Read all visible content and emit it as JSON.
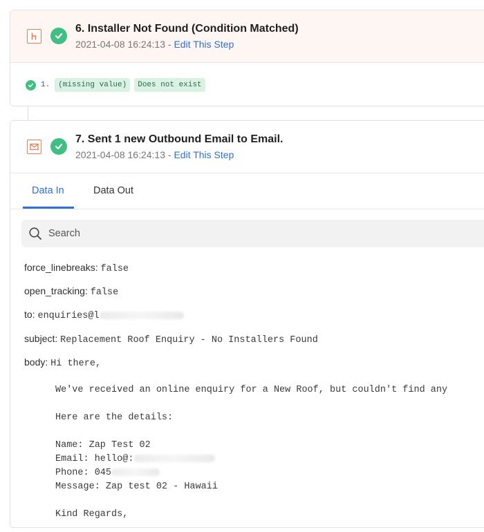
{
  "step6": {
    "title": "6. Installer Not Found (Condition Matched)",
    "timestamp": "2021-04-08 16:24:13",
    "separator": " - ",
    "edit_label": "Edit This Step",
    "app_icon": "filter-icon",
    "condition": {
      "number": "1.",
      "value_tag": "(missing value)",
      "operator_tag": "Does not exist"
    }
  },
  "step7": {
    "title": "7. Sent 1 new Outbound Email to Email.",
    "timestamp": "2021-04-08 16:24:13",
    "separator": " - ",
    "edit_label": "Edit This Step",
    "app_icon": "email-icon",
    "tabs": [
      {
        "label": "Data In",
        "active": true
      },
      {
        "label": "Data Out",
        "active": false
      }
    ],
    "search": {
      "placeholder": "Search"
    },
    "fields": {
      "force_linebreaks": {
        "key": "force_linebreaks:",
        "value": "false"
      },
      "open_tracking": {
        "key": "open_tracking:",
        "value": "false"
      },
      "to": {
        "key": "to:",
        "value": "enquiries@l"
      },
      "subject": {
        "key": "subject:",
        "value": "Replacement Roof Enquiry - No Installers Found"
      },
      "body": {
        "key": "body:",
        "first_line": "Hi there,",
        "lines": [
          "We've received an online enquiry for a New Roof, but couldn't find any",
          "Here are the details:",
          "Name: Zap Test 02",
          "Email: hello@:",
          "Phone: 045",
          "Message: Zap test 02 - Hawaii",
          "Kind Regards,"
        ]
      }
    }
  },
  "colors": {
    "success": "#3fbf82",
    "link": "#2d6fd6",
    "app_accent": "#e97b55",
    "tag_bg": "#daf2e3"
  }
}
